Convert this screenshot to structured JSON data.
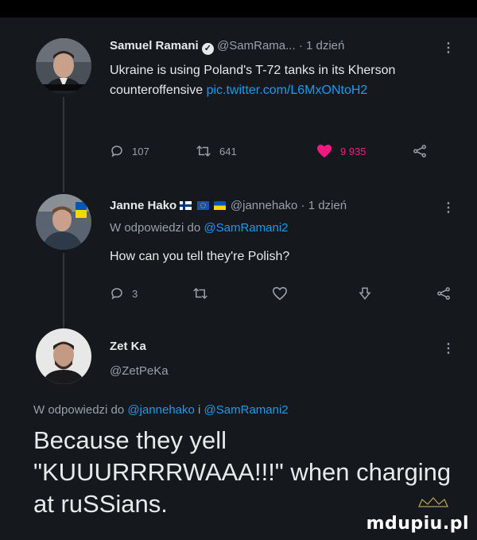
{
  "tweet1": {
    "name": "Samuel Ramani",
    "handle": "@SamRama...",
    "time": "· 1 dzień",
    "text": "Ukraine is using Poland's T-72 tanks in its Kherson counteroffensive ",
    "link": "pic.twitter.com/L6MxONtoH2",
    "replies": "107",
    "retweets": "641",
    "likes": "9 935"
  },
  "tweet2": {
    "name": "Janne Hako",
    "handle": "@jannehako",
    "time": "· 1 dzień",
    "reply_prefix": "W odpowiedzi do ",
    "reply_to": "@SamRamani2",
    "text": "How can you tell they're Polish?",
    "replies": "3"
  },
  "tweet3": {
    "name": "Zet Ka",
    "handle": "@ZetPeKa",
    "reply_prefix": "W odpowiedzi do ",
    "reply_to_1": "@jannehako",
    "reply_joiner": " i ",
    "reply_to_2": "@SamRamani2",
    "text": "Because they yell \"KUUURRRRWAAA!!!\" when charging at ruSSians."
  },
  "more_icon": "⋮",
  "watermark": "mdupiu.pl",
  "colors": {
    "background": "#15181c",
    "link": "#1d9bf0",
    "like": "#f91880",
    "muted": "#9aa0a6"
  }
}
